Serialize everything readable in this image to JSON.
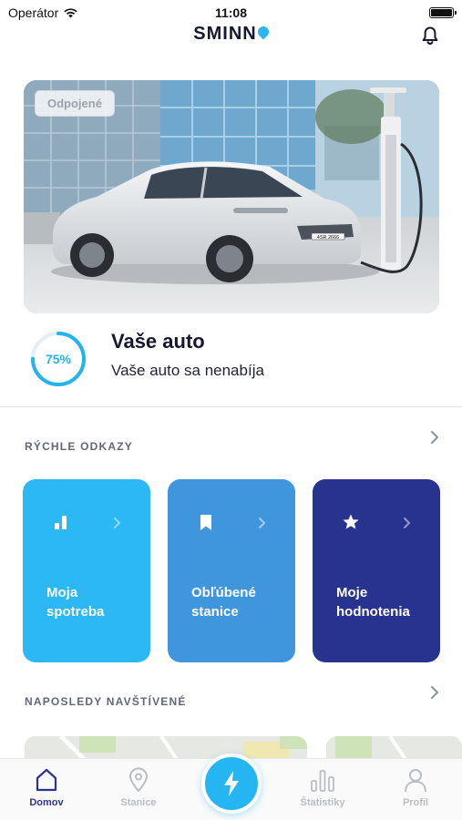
{
  "status_bar": {
    "carrier": "Operátor",
    "time": "11:08"
  },
  "header": {
    "logo": "SMINN"
  },
  "car": {
    "status_badge": "Odpojené",
    "charge_percent": 75,
    "charge_label": "75%",
    "title": "Vaše auto",
    "subtitle": "Vaše auto sa nenabíja",
    "plate": "4SR 2666"
  },
  "quick_links": {
    "title": "RÝCHLE ODKAZY",
    "items": [
      {
        "label": "Moja spotreba",
        "icon": "bar-chart-icon",
        "color": "#2bb8f5"
      },
      {
        "label": "Obľúbené stanice",
        "icon": "bookmark-icon",
        "color": "#3f96dd"
      },
      {
        "label": "Moje hodnotenia",
        "icon": "star-icon",
        "color": "#28338f"
      }
    ]
  },
  "recent": {
    "title": "NAPOSLEDY NAVŠTÍVENÉ"
  },
  "tab_bar": {
    "items": [
      {
        "label": "Domov",
        "icon": "home-icon",
        "active": true
      },
      {
        "label": "Stanice",
        "icon": "location-pin-icon",
        "active": false
      },
      {
        "label": "Štatistiky",
        "icon": "stats-icon",
        "active": false
      },
      {
        "label": "Profil",
        "icon": "profile-icon",
        "active": false
      }
    ],
    "center_icon": "lightning-icon"
  },
  "colors": {
    "accent": "#25b5f2",
    "navy": "#2c3390",
    "inactive": "#b9bdc3"
  }
}
